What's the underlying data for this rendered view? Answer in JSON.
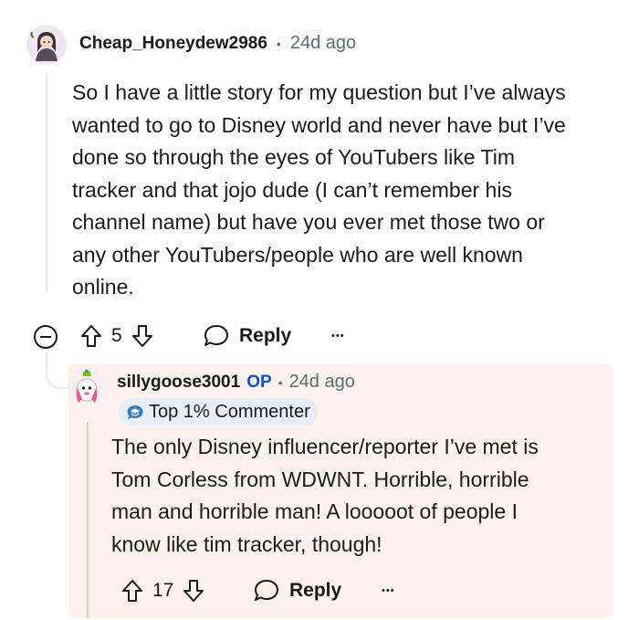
{
  "comment": {
    "username": "Cheap_Honeydew2986",
    "time": "24d ago",
    "body_lines": [
      "So I have a little story for my question but I’ve always",
      "wanted to go to Disney world and never have but I’ve",
      "done so through the eyes of YouTubers like Tim",
      "tracker and that jojo dude (I can’t remember his",
      "channel name) but have you ever met those two or",
      "any other YouTubers/people who are well known",
      "online."
    ],
    "score": "5",
    "reply_label": "Reply",
    "more": "•••"
  },
  "reply": {
    "username": "sillygoose3001",
    "op_label": "OP",
    "time": "24d ago",
    "badge": "Top 1% Commenter",
    "body_lines": [
      "The only Disney influencer/reporter I’ve met is",
      "Tom Corless from WDWNT. Horrible, horrible",
      "man and horrible man! A looooot of people I",
      "know like tim tracker, though!"
    ],
    "score": "17",
    "reply_label": "Reply",
    "more": "•••"
  },
  "colors": {
    "reply_bg": "#fdf2ec",
    "op": "#0a53c8",
    "meta": "#576f76"
  }
}
